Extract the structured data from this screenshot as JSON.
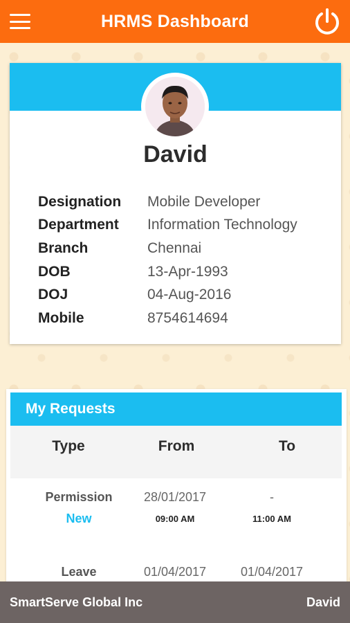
{
  "header": {
    "title": "HRMS Dashboard",
    "menu_icon": "hamburger-menu-icon",
    "power_icon": "power-icon"
  },
  "profile": {
    "name": "David",
    "details": [
      {
        "label": "Designation",
        "value": "Mobile Developer"
      },
      {
        "label": "Department",
        "value": "Information Technology"
      },
      {
        "label": "Branch",
        "value": "Chennai"
      },
      {
        "label": "DOB",
        "value": "13-Apr-1993"
      },
      {
        "label": "DOJ",
        "value": "04-Aug-2016"
      },
      {
        "label": "Mobile",
        "value": "8754614694"
      }
    ]
  },
  "requests": {
    "title": "My Requests",
    "columns": [
      "Type",
      "From",
      "To"
    ],
    "rows": [
      {
        "type": "Permission",
        "status": "New",
        "from_date": "28/01/2017",
        "from_time": "09:00 AM",
        "to_date": "-",
        "to_time": "11:00 AM"
      },
      {
        "type": "Leave",
        "status": "",
        "from_date": "01/04/2017",
        "from_time": "",
        "to_date": "01/04/2017",
        "to_time": ""
      }
    ]
  },
  "footer": {
    "company": "SmartServe Global Inc",
    "user": "David"
  },
  "colors": {
    "header": "#fc6c0f",
    "accent": "#1bbdf0",
    "footer": "#6d6463",
    "background": "#fcefd4"
  }
}
